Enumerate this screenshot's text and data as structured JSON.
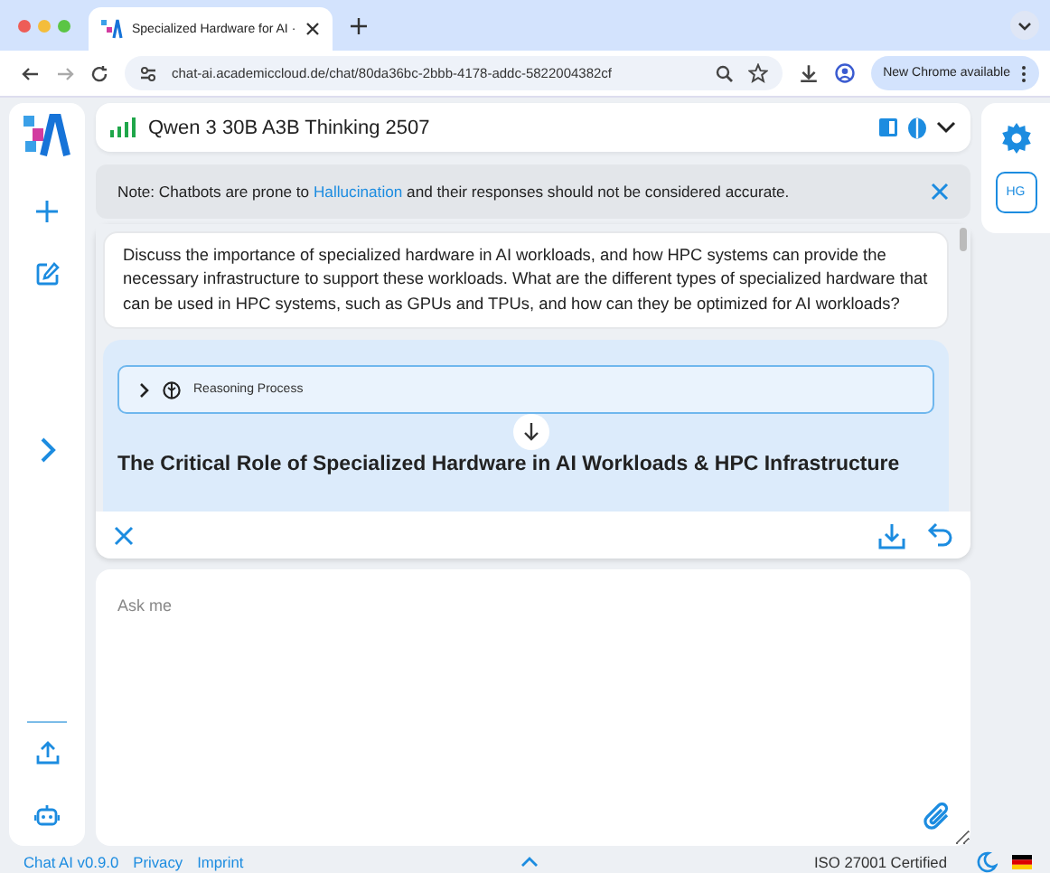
{
  "browser": {
    "tab_title": "Specialized Hardware for AI ·",
    "url": "chat-ai.academiccloud.de/chat/80da36bc-2bbb-4178-addc-5822004382cf",
    "update_button": "New Chrome available"
  },
  "model": {
    "name": "Qwen 3 30B A3B Thinking 2507"
  },
  "note": {
    "before": "Note: Chatbots are prone to ",
    "link": "Hallucination",
    "after": " and their responses should not be considered accurate."
  },
  "user_message": "Discuss the importance of specialized hardware in AI workloads, and how HPC systems can provide the necessary infrastructure to support these workloads. What are the different types of specialized hardware that can be used in HPC systems, such as GPUs and TPUs, and how can they be optimized for AI workloads?",
  "reasoning": {
    "label": "Reasoning Process",
    "expanded": false
  },
  "response_heading": "The Critical Role of Specialized Hardware in AI Workloads & HPC Infrastructure",
  "input": {
    "placeholder": "Ask me"
  },
  "user": {
    "initials": "HG"
  },
  "footer": {
    "version": "Chat AI v0.9.0",
    "links": [
      "Privacy",
      "Imprint"
    ],
    "certification": "ISO 27001 Certified"
  }
}
